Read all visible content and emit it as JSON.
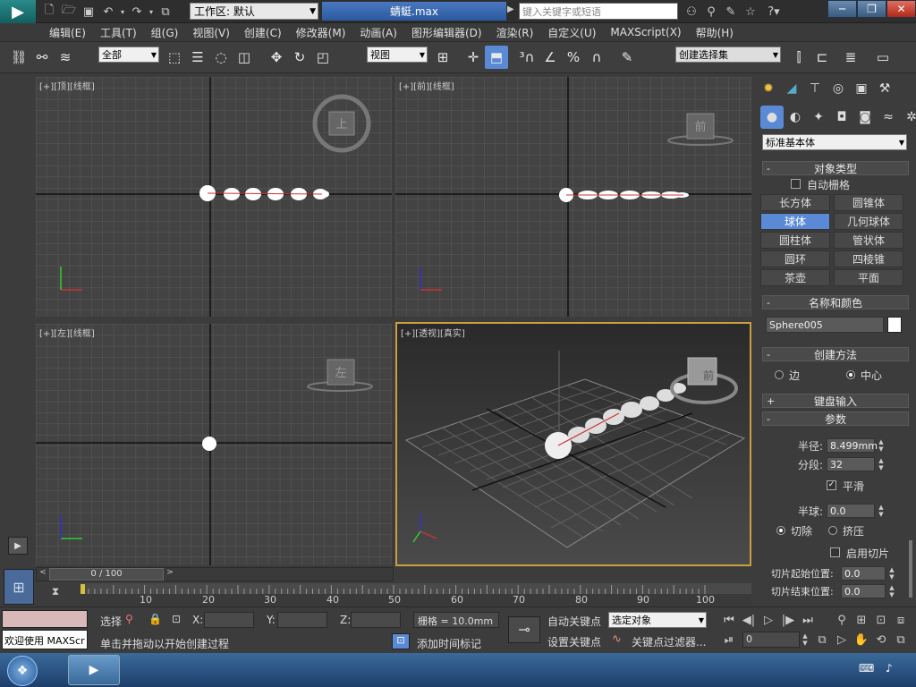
{
  "titlebar": {
    "workspace": "工作区: 默认",
    "doc_title": "蜻蜓.max",
    "search_placeholder": "键入关键字或短语"
  },
  "menu": [
    "编辑(E)",
    "工具(T)",
    "组(G)",
    "视图(V)",
    "创建(C)",
    "修改器(M)",
    "动画(A)",
    "图形编辑器(D)",
    "渲染(R)",
    "自定义(U)",
    "MAXScript(X)",
    "帮助(H)"
  ],
  "toolbar": {
    "filter": "全部",
    "refcoord": "视图",
    "selset": "创建选择集"
  },
  "viewports": {
    "top": "[+][顶][线框]",
    "front": "[+][前][线框]",
    "left": "[+][左][线框]",
    "persp": "[+][透视][真实]",
    "cube_top": "上",
    "cube_front": "前",
    "cube_left": "左",
    "cube_persp": "前"
  },
  "panel": {
    "category": "标准基本体",
    "object_type": "对象类型",
    "autogrid": "自动栅格",
    "buttons": [
      "长方体",
      "圆锥体",
      "球体",
      "几何球体",
      "圆柱体",
      "管状体",
      "圆环",
      "四棱锥",
      "茶壶",
      "平面"
    ],
    "name_color": "名称和颜色",
    "object_name": "Sphere005",
    "creation_method": "创建方法",
    "edge": "边",
    "center": "中心",
    "keyboard_entry": "键盘输入",
    "parameters": "参数",
    "radius_label": "半径:",
    "radius": "8.499mm",
    "segments_label": "分段:",
    "segments": "32",
    "smooth": "平滑",
    "hemisphere_label": "半球:",
    "hemisphere": "0.0",
    "chop": "切除",
    "squash": "挤压",
    "slice_on": "启用切片",
    "slice_from_label": "切片起始位置:",
    "slice_from": "0.0",
    "slice_to_label": "切片结束位置:",
    "slice_to": "0.0"
  },
  "timeline": {
    "frame": "0 / 100",
    "ticks": [
      "10",
      "20",
      "30",
      "40",
      "50",
      "60",
      "70",
      "80",
      "90",
      "100"
    ]
  },
  "status": {
    "welcome": "欢迎使用 MAXScr",
    "sel_label": "选择",
    "x": "X:",
    "y": "Y:",
    "z": "Z:",
    "grid": "栅格 = 10.0mm",
    "prompt": "单击并拖动以开始创建过程",
    "add_time_tag": "添加时间标记",
    "auto_key": "自动关键点",
    "set_key": "设置关键点",
    "key_mode": "选定对象",
    "key_filters": "关键点过滤器...",
    "frame_field": "0"
  }
}
